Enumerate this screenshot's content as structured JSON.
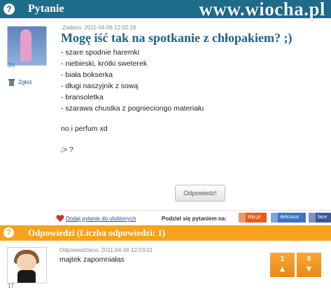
{
  "question_header": {
    "title": "Pytanie",
    "watermark": "www.wiocha.pl",
    "help_symbol": "?"
  },
  "question": {
    "author": "3N",
    "delete_label": "Zgłoś",
    "added": "Zadano: 2011-04-06 12:02:18",
    "title": "Mogę iść tak na spotkanie z chłopakiem? ;)",
    "items": [
      "- szare spodnie haremki",
      "- niebieski, krótki sweterek",
      "- biała bokserka",
      "- długi naszyjnik z sową",
      "- bransoletka",
      "- szarawa chustka z pognieciongo materiału"
    ],
    "extra1": "no i perfum xd",
    "extra2": ";> ?",
    "answer_button": "Odpowiedz!"
  },
  "share": {
    "fav_link": "Dodaj pytanie do ulubionych",
    "share_label": "Podziel się pytaniem na:",
    "services": [
      "blip.pl",
      "delicious",
      "face"
    ]
  },
  "answers_header": {
    "title": "Odpowiedzi (Liczba odpowiedzi: 1)",
    "help_symbol": "?"
  },
  "answer": {
    "author": "17",
    "replied": "Odpowiedziano: 2011-04-06 12:03:01",
    "text": "majtek zapomniałas",
    "votes_up": "1",
    "votes_down": "0"
  },
  "colors": {
    "question_header": "#1f6b8a",
    "answers_header": "#f6a31b",
    "title_blue": "#1f5f88"
  }
}
